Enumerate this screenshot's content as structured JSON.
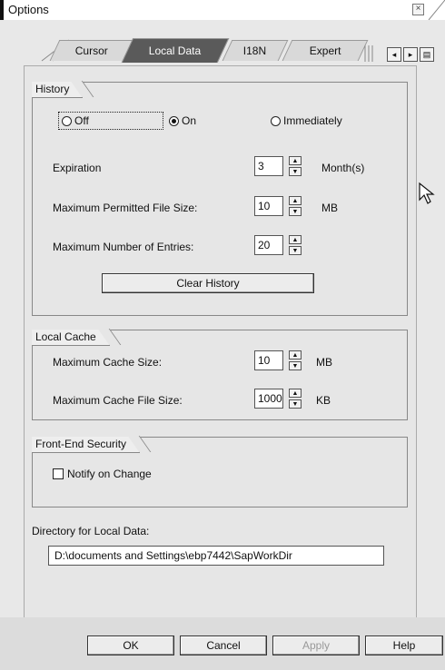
{
  "window": {
    "title": "Options"
  },
  "tabs": [
    {
      "label": "Cursor"
    },
    {
      "label": "Local Data"
    },
    {
      "label": "I18N"
    },
    {
      "label": "Expert"
    }
  ],
  "tab_nav": {
    "prev_icon": "◂",
    "next_icon": "▸",
    "menu_icon": "▤"
  },
  "history": {
    "title": "History",
    "radio_off": "Off",
    "radio_on": "On",
    "radio_immediately": "Immediately",
    "selected": "On",
    "expiration_label": "Expiration",
    "expiration_value": "3",
    "expiration_unit": "Month(s)",
    "max_file_size_label": "Maximum Permitted File Size:",
    "max_file_size_value": "10",
    "max_file_size_unit": "MB",
    "max_entries_label": "Maximum Number of Entries:",
    "max_entries_value": "20",
    "clear_button": "Clear History"
  },
  "local_cache": {
    "title": "Local Cache",
    "max_cache_size_label": "Maximum Cache Size:",
    "max_cache_size_value": "10",
    "max_cache_size_unit": "MB",
    "max_cache_file_size_label": "Maximum Cache File Size:",
    "max_cache_file_size_value": "1000",
    "max_cache_file_size_unit": "KB"
  },
  "frontend_security": {
    "title": "Front-End Security",
    "notify_label": "Notify on Change",
    "notify_checked": false
  },
  "directory": {
    "label": "Directory for Local Data:",
    "value": "D:\\documents and Settings\\ebp7442\\SapWorkDir"
  },
  "footer": {
    "ok": "OK",
    "cancel": "Cancel",
    "apply": "Apply",
    "help": "Help"
  },
  "spin_icons": {
    "up": "▲",
    "down": "▼"
  }
}
